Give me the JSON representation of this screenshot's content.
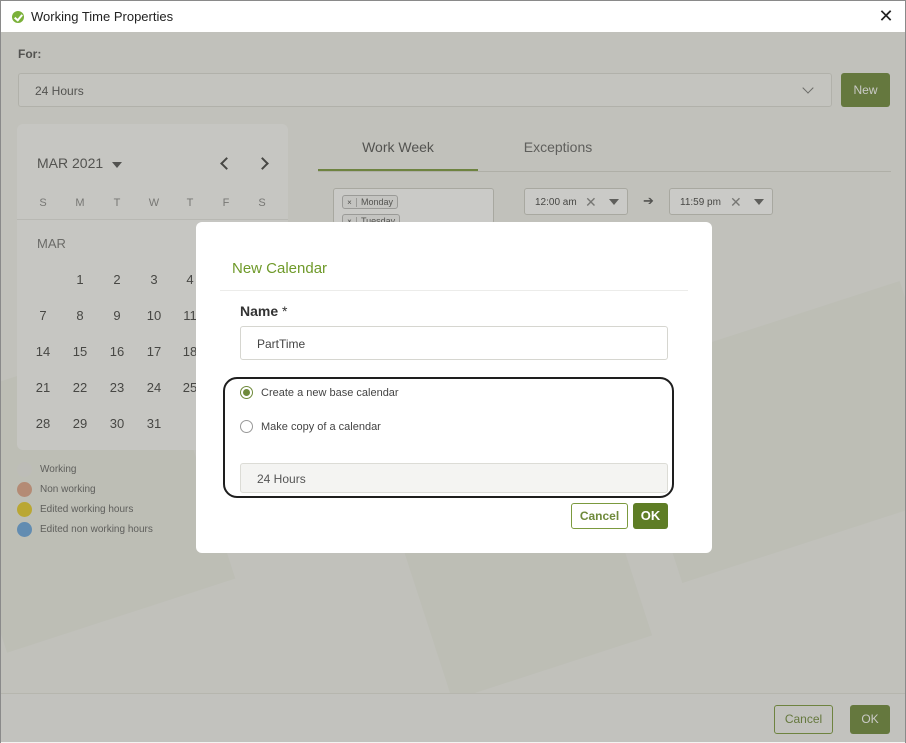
{
  "window": {
    "title": "Working Time Properties"
  },
  "for_section": {
    "label": "For:",
    "selected": "24 Hours",
    "new_label": "New"
  },
  "calendar": {
    "month_year": "MAR 2021",
    "weekdays": [
      "S",
      "M",
      "T",
      "W",
      "T",
      "F",
      "S"
    ],
    "month_label": "MAR",
    "weeks": [
      [
        "",
        "1",
        "2",
        "3",
        "4",
        "",
        ""
      ],
      [
        "7",
        "8",
        "9",
        "10",
        "11",
        "",
        ""
      ],
      [
        "14",
        "15",
        "16",
        "17",
        "18",
        "",
        ""
      ],
      [
        "21",
        "22",
        "23",
        "24",
        "25",
        "",
        ""
      ],
      [
        "28",
        "29",
        "30",
        "31",
        "",
        "",
        ""
      ]
    ]
  },
  "legend": [
    {
      "label": "Working",
      "color": "#ececea"
    },
    {
      "label": "Non working",
      "color": "#e0a58a"
    },
    {
      "label": "Edited working hours",
      "color": "#e9cd2c"
    },
    {
      "label": "Edited non working hours",
      "color": "#6aa7e0"
    }
  ],
  "tabs": [
    {
      "label": "Work Week",
      "active": true
    },
    {
      "label": "Exceptions",
      "active": false
    }
  ],
  "work_week": {
    "day_chips": [
      "Monday",
      "Tuesday"
    ],
    "start_time": "12:00 am",
    "end_time": "11:59 pm"
  },
  "footer": {
    "cancel_label": "Cancel",
    "ok_label": "OK"
  },
  "modal": {
    "title": "New Calendar",
    "name_label": "Name",
    "required_mark": "*",
    "name_value": "PartTime",
    "option_new": "Create a new base calendar",
    "option_copy": "Make copy of a calendar",
    "selected_option": "new",
    "copy_source": "24 Hours",
    "cancel_label": "Cancel",
    "ok_label": "OK"
  }
}
